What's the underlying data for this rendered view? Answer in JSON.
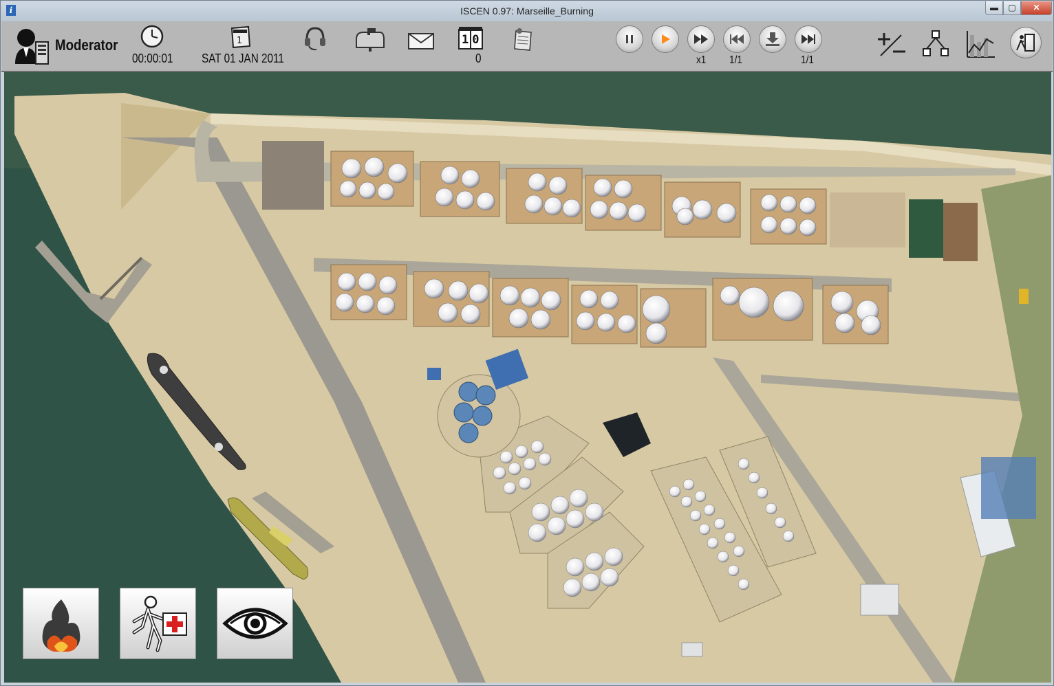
{
  "window": {
    "title": "ISCEN  0.97: Marseille_Burning",
    "controls": {
      "minimize": "▬",
      "maximize": "▢",
      "close": "✕"
    }
  },
  "toolbar": {
    "role": "Moderator",
    "elapsed_time": "00:00:01",
    "date": "SAT 01 JAN 2011",
    "counter": "0",
    "counter_icon_label": "10",
    "speed": "x1",
    "rewind_step": "1/1",
    "forward_step": "1/1"
  },
  "icons": {
    "role": "moderator-avatar-icon",
    "clock": "clock-icon",
    "calendar": "calendar-icon",
    "headset": "headset-icon",
    "mailbox": "mailbox-icon",
    "envelope": "envelope-icon",
    "counter": "counter-icon",
    "notes": "notes-icon",
    "pause": "pause-icon",
    "play": "play-icon",
    "fast_forward": "fast-forward-icon",
    "rewind": "rewind-icon",
    "download": "download-icon",
    "skip_forward": "skip-forward-icon",
    "plus_minus": "plus-minus-icon",
    "network": "network-icon",
    "chart": "chart-icon",
    "exit": "exit-icon"
  },
  "actions": [
    {
      "name": "fire-button",
      "icon": "fire-icon"
    },
    {
      "name": "casualty-button",
      "icon": "injured-person-icon"
    },
    {
      "name": "observe-button",
      "icon": "eye-icon"
    }
  ],
  "colors": {
    "toolbar_bg": "#b7b7b7",
    "play_accent": "#ff8c1a",
    "water": "#2f5347",
    "land": "#d7c9a3"
  }
}
